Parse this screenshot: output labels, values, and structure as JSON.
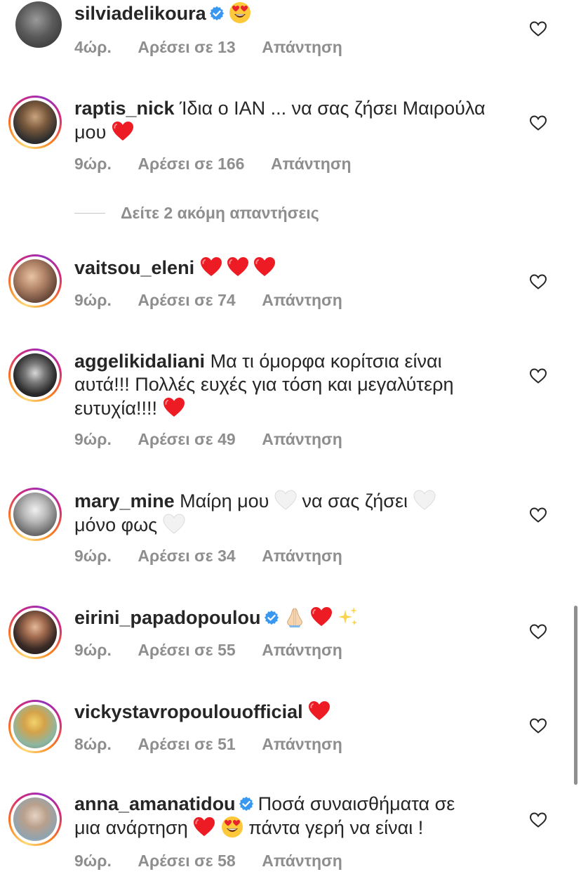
{
  "comments": [
    {
      "username": "silviadelikoura",
      "verified": true,
      "text": "",
      "emoji": [
        "heart-eyes"
      ],
      "time": "4ώρ.",
      "likes": "Αρέσει σε 13",
      "reply": "Απάντηση"
    },
    {
      "username": "raptis_nick",
      "verified": false,
      "text": "Ίδια ο ΙΑΝ ... να σας ζήσει Μαιρούλα μου",
      "emoji": [
        "red-heart"
      ],
      "time": "9ώρ.",
      "likes": "Αρέσει σε 166",
      "reply": "Απάντηση"
    },
    {
      "username": "vaitsou_eleni",
      "verified": false,
      "text": "",
      "emoji": [
        "red-heart",
        "red-heart",
        "red-heart"
      ],
      "time": "9ώρ.",
      "likes": "Αρέσει σε 74",
      "reply": "Απάντηση"
    },
    {
      "username": "aggelikidaliani",
      "verified": false,
      "text_line1": "Μα τι όμορφα κορίτσια είναι",
      "text_line2": "αυτά!!! Πολλές ευχές για τόση και μεγαλύτερη",
      "text_line3": "ευτυχία!!!!",
      "emoji": [
        "red-heart"
      ],
      "time": "9ώρ.",
      "likes": "Αρέσει σε 49",
      "reply": "Απάντηση"
    },
    {
      "username": "mary_mine",
      "verified": false,
      "text_part1": "Μαίρη μου",
      "text_part2": "να σας ζήσει",
      "text_part3": "μόνο φως",
      "emoji": [
        "white-heart",
        "white-heart",
        "white-heart"
      ],
      "time": "9ώρ.",
      "likes": "Αρέσει σε 34",
      "reply": "Απάντηση"
    },
    {
      "username": "eirini_papadopoulou",
      "verified": true,
      "text": "",
      "emoji": [
        "folded-hands",
        "red-heart",
        "sparkles"
      ],
      "time": "9ώρ.",
      "likes": "Αρέσει σε 55",
      "reply": "Απάντηση"
    },
    {
      "username": "vickystavropoulouofficial",
      "verified": false,
      "text": "",
      "emoji": [
        "red-heart"
      ],
      "time": "8ώρ.",
      "likes": "Αρέσει σε 51",
      "reply": "Απάντηση"
    },
    {
      "username": "anna_amanatidou",
      "verified": true,
      "text_line1": "Ποσά συναισθήματα σε",
      "text_line2a": "μια ανάρτηση",
      "text_line2b": "πάντα γερή να είναι !",
      "emoji": [
        "red-heart",
        "heart-eyes"
      ],
      "time": "9ώρ.",
      "likes": "Αρέσει σε 58",
      "reply": "Απάντηση"
    }
  ],
  "more_replies": "Δείτε 2 ακόμη απαντήσεις",
  "colors": {
    "text": "#262626",
    "meta": "#8e8e8e",
    "verified": "#3897f0",
    "heart": "#ed1c24"
  }
}
